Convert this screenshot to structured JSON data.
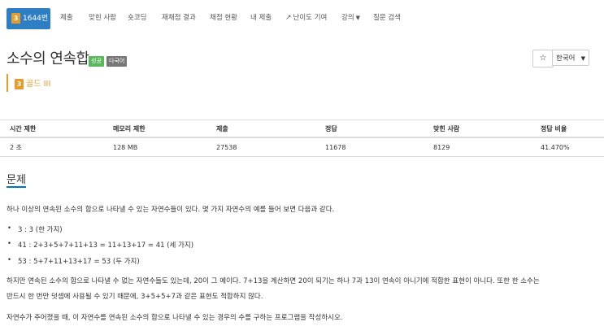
{
  "nav": {
    "problem_number": "1644번",
    "tier_digit": "3",
    "items": [
      "제출",
      "맞힌 사람",
      "숏코딩",
      "재채점 결과",
      "채점 현황",
      "내 제출",
      "난이도 기여",
      "강의",
      "질문 검색"
    ]
  },
  "problem": {
    "title": "소수의 연속합",
    "badge_success": "성공",
    "badge_lang": "다국어",
    "tier_digit": "3",
    "tier_label": "골드 III"
  },
  "controls": {
    "star": "☆",
    "language": "한국어"
  },
  "colors": {
    "nav_active": "#2e7ec4",
    "gold": "#e69b2c",
    "success": "#5cb85c",
    "section_underline": "#0076c0"
  },
  "info": {
    "headers": [
      "시간 제한",
      "메모리 제한",
      "제출",
      "정답",
      "맞힌 사람",
      "정답 비율"
    ],
    "values": [
      "2 초",
      "128 MB",
      "27538",
      "11678",
      "8129",
      "41.470%"
    ]
  },
  "section": {
    "title": "문제",
    "intro": "하나 이상의 연속된 소수의 합으로 나타낼 수 있는 자연수들이 있다. 몇 가지 자연수의 예를 들어 보면 다음과 같다.",
    "examples": [
      "3 : 3 (한 가지)",
      "41 : 2+3+5+7+11+13 = 11+13+17 = 41 (세 가지)",
      "53 : 5+7+11+13+17 = 53 (두 가지)"
    ],
    "para2_line1": "하지만 연속된 소수의 합으로 나타낼 수 없는 자연수들도 있는데, 20이 그 예이다. 7+13을 계산하면 20이 되기는 하나 7과 13이 연속이 아니기에 적합한 표현이 아니다. 또한 한 소수는",
    "para2_line2": "반드시 한 번만 덧셈에 사용될 수 있기 때문에, 3+5+5+7과 같은 표현도 적합하지 않다.",
    "para3": "자연수가 주어졌을 때, 이 자연수를 연속된 소수의 합으로 나타낼 수 있는 경우의 수를 구하는 프로그램을 작성하시오."
  }
}
